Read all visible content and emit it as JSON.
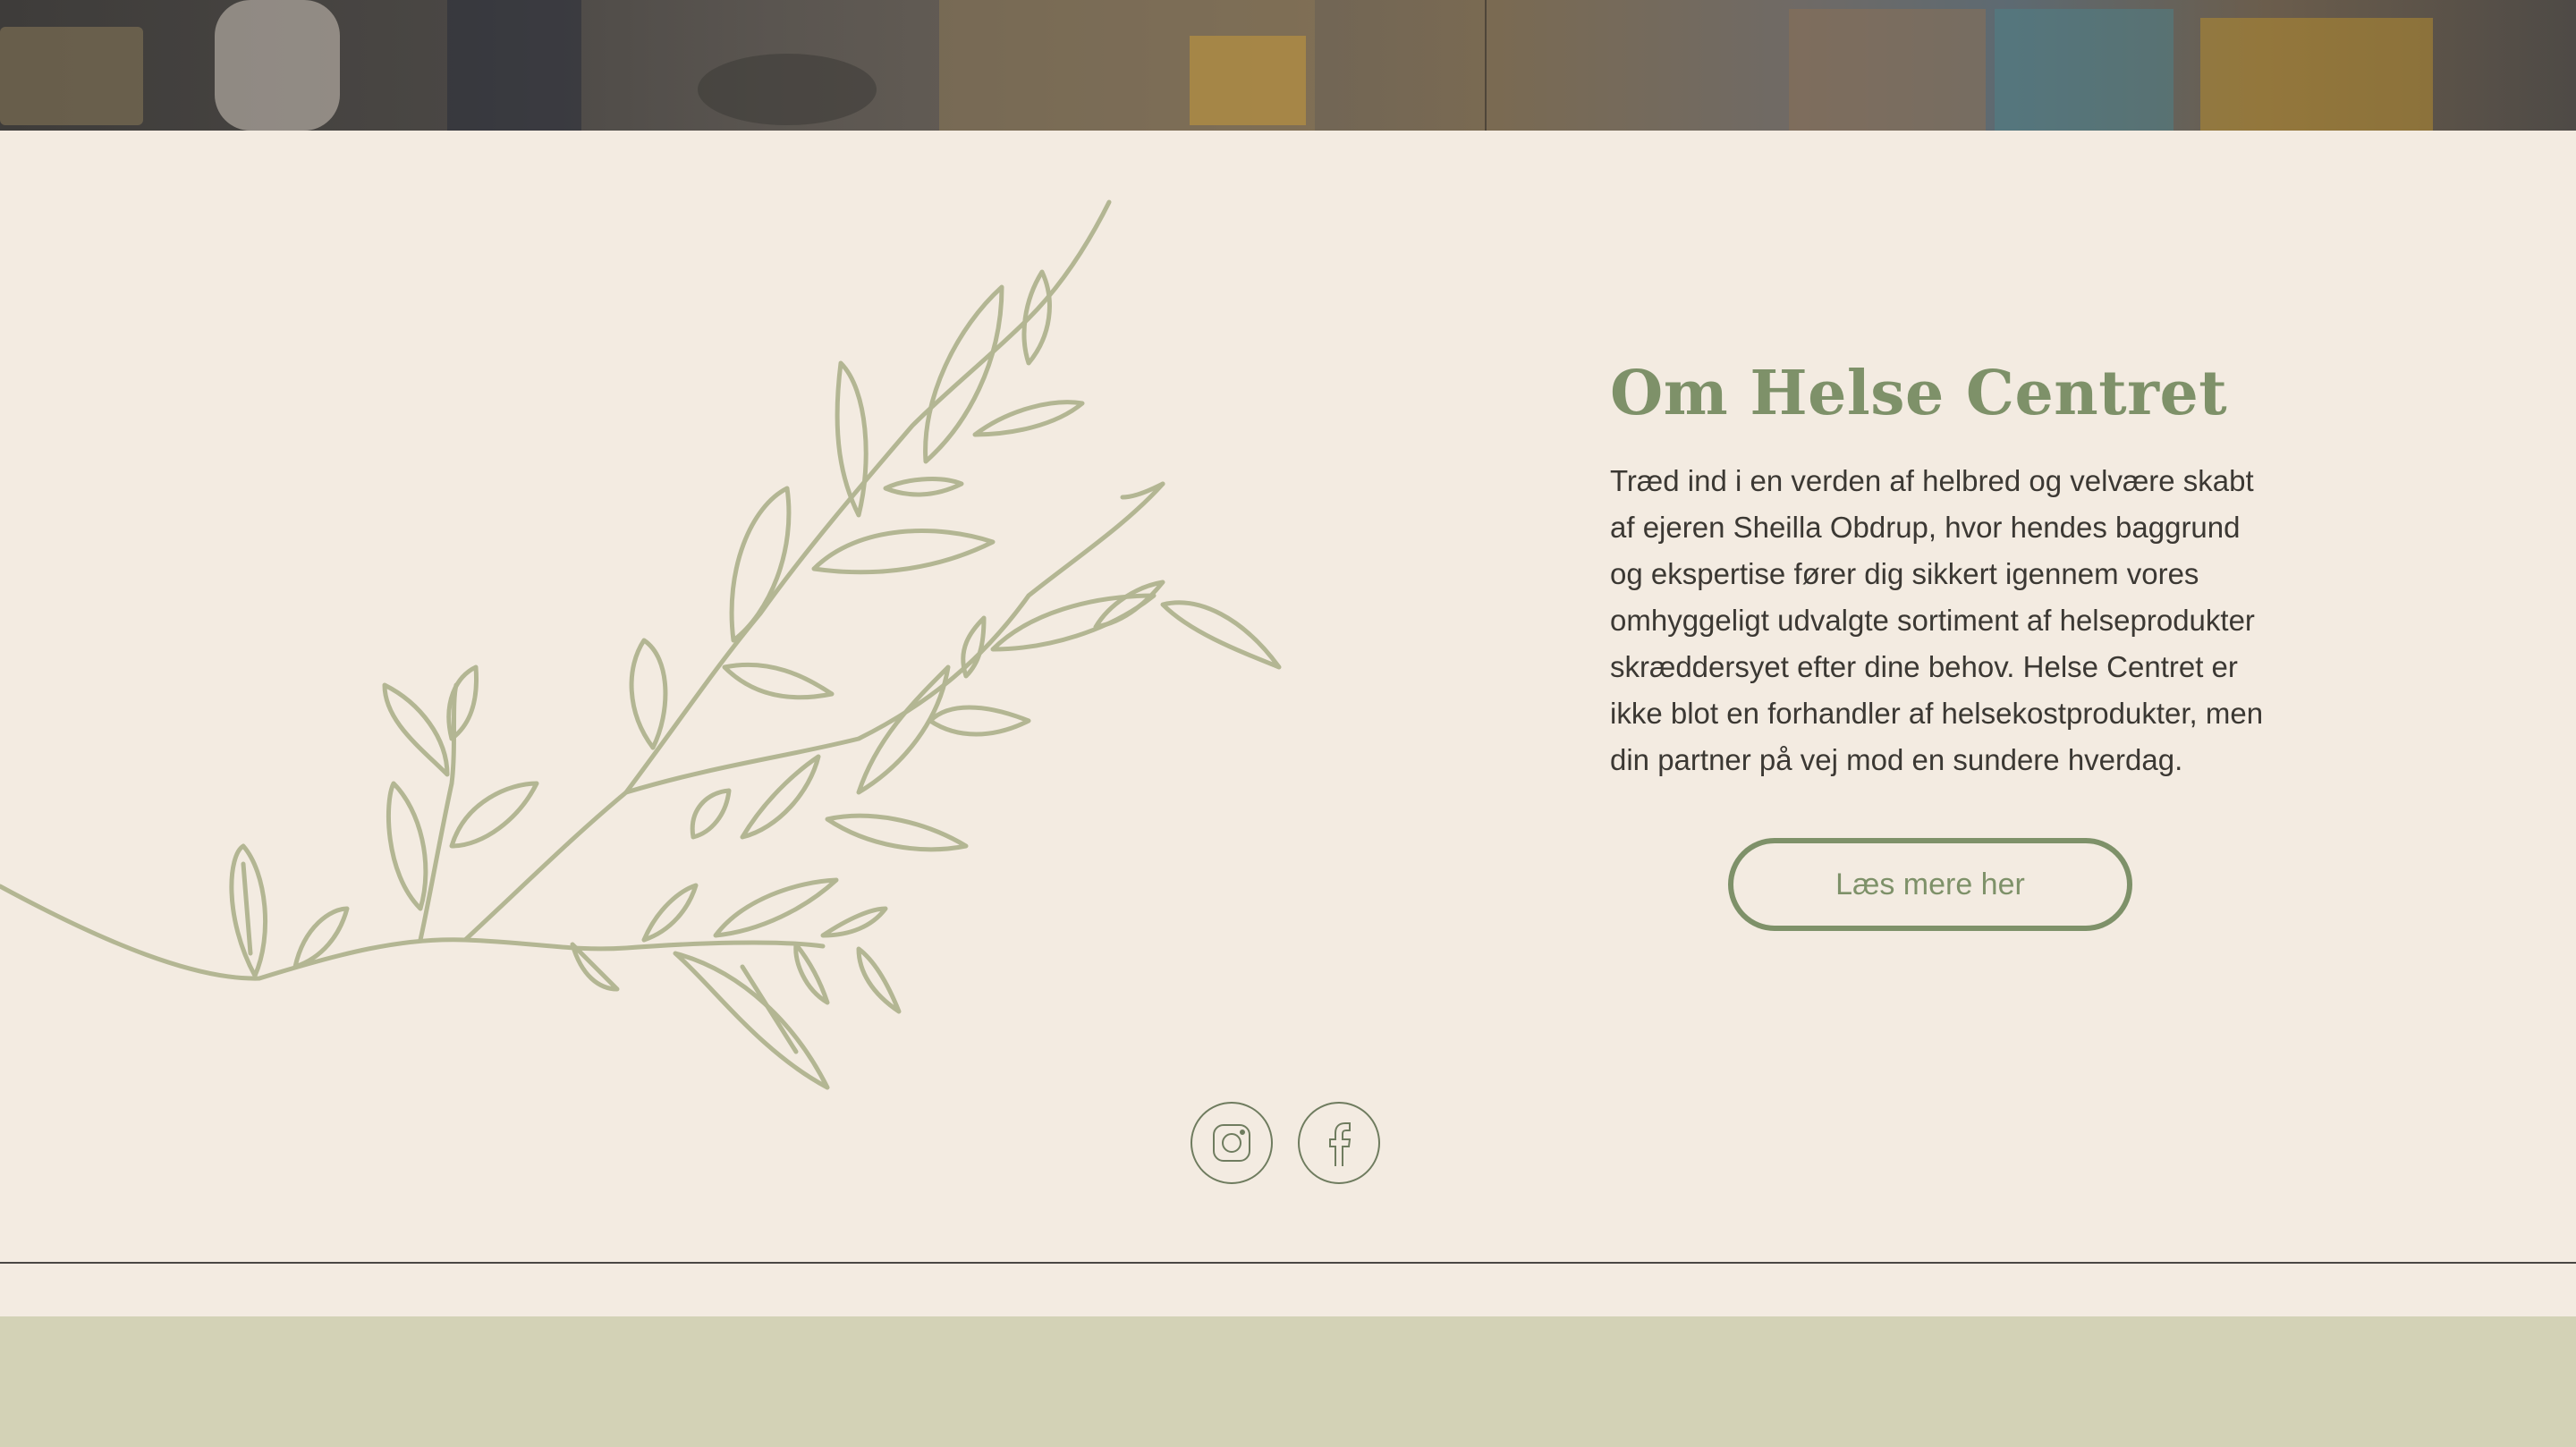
{
  "colors": {
    "background": "#f3ebe1",
    "accent": "#7e9169",
    "branch": "#b3b693",
    "text": "#3b3833",
    "footer": "#d3d2b6"
  },
  "about": {
    "title": "Om Helse Centret",
    "body": "Træd ind i en verden af helbred og velvære skabt af ejeren Sheilla Obdrup, hvor hendes baggrund og ekspertise fører dig sikkert igennem vores omhyggeligt udvalgte sortiment af helseprodukter skræddersyet efter dine behov. Helse Centret er ikke blot en forhandler af helsekostprodukter, men din partner på vej mod en sundere hverdag.",
    "button_label": "Læs mere her"
  },
  "social": {
    "items": [
      {
        "icon": "instagram-icon"
      },
      {
        "icon": "facebook-icon"
      }
    ]
  }
}
